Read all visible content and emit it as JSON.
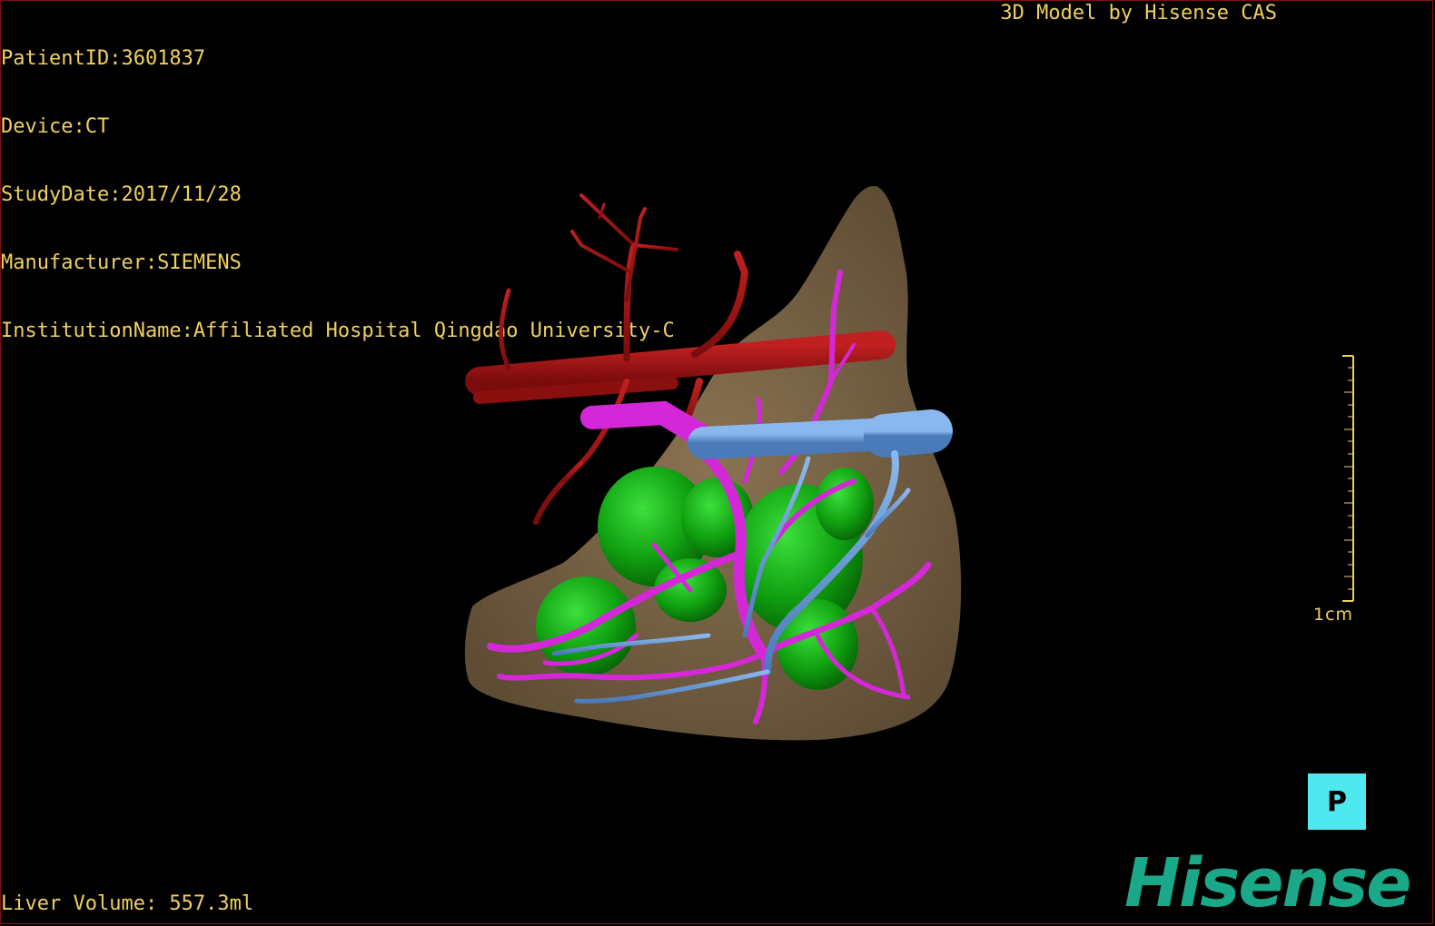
{
  "header": {
    "patient_id": "PatientID:3601837",
    "device": "Device:CT",
    "study_date": "StudyDate:2017/11/28",
    "manufacturer": "Manufacturer:SIEMENS",
    "institution": "InstitutionName:Affiliated Hospital Qingdao University-C"
  },
  "credit": "3D Model by Hisense CAS",
  "footer": {
    "liver_volume": "Liver Volume: 557.3ml"
  },
  "scale": {
    "label": "1cm"
  },
  "orientation_marker": {
    "label": "P",
    "color": "#4fe8f0"
  },
  "brand": {
    "logo_text": "Hisense",
    "color": "#1aa889"
  },
  "model_colors": {
    "liver": "#7a6548",
    "artery": "#a01515",
    "portal_vein": "#d428d8",
    "hepatic_vein": "#6a9ed8",
    "lesion": "#10a010"
  }
}
